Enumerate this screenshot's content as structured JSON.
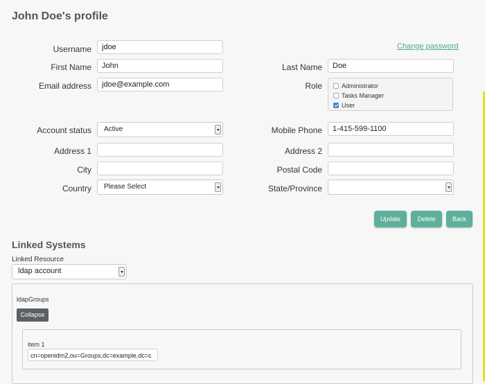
{
  "profile": {
    "title": "John Doe's profile",
    "change_password": "Change password",
    "fields": {
      "username": {
        "label": "Username",
        "value": "jdoe"
      },
      "first_name": {
        "label": "First Name",
        "value": "John"
      },
      "email": {
        "label": "Email address",
        "value": "jdoe@example.com"
      },
      "last_name": {
        "label": "Last Name",
        "value": "Doe"
      },
      "role": {
        "label": "Role"
      },
      "account_status": {
        "label": "Account status",
        "value": "Active"
      },
      "mobile_phone": {
        "label": "Mobile Phone",
        "value": "1-415-599-1100"
      },
      "address1": {
        "label": "Address 1",
        "value": ""
      },
      "address2": {
        "label": "Address 2",
        "value": ""
      },
      "city": {
        "label": "City",
        "value": ""
      },
      "postal_code": {
        "label": "Postal Code",
        "value": ""
      },
      "country": {
        "label": "Country",
        "value": "Please Select"
      },
      "state": {
        "label": "State/Province",
        "value": ""
      }
    },
    "roles": [
      {
        "label": "Administrator",
        "checked": false
      },
      {
        "label": "Tasks Manager",
        "checked": false
      },
      {
        "label": "User",
        "checked": true
      }
    ],
    "buttons": {
      "update": "Update",
      "delete": "Delete",
      "back": "Back"
    }
  },
  "linked": {
    "title": "Linked Systems",
    "resource_label": "Linked Resource",
    "resource_value": "ldap account",
    "group_label": "ldapGroups",
    "collapse": "Collapse",
    "item_label": "item 1",
    "item_value": "cn=openidm2,ou=Groups,dc=example,dc=c"
  },
  "colors": {
    "accent": "#5eaf9c",
    "link": "#4aa99b",
    "highlight_bar": "#e2e21e"
  }
}
